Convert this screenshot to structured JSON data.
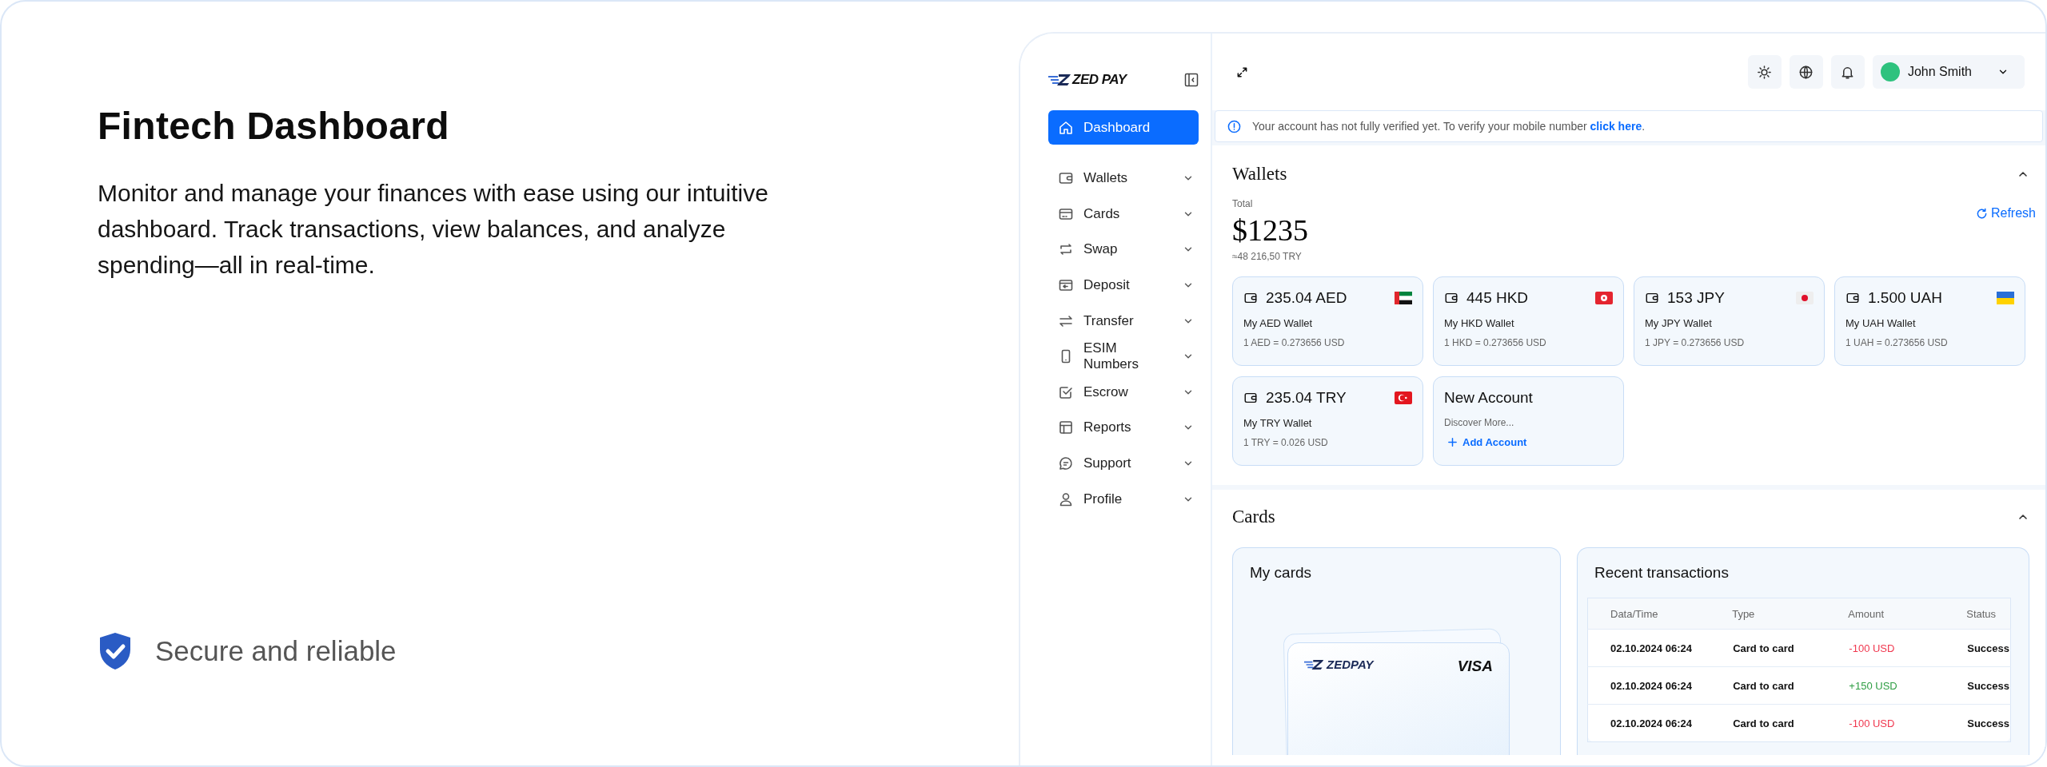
{
  "intro": {
    "title": "Fintech Dashboard",
    "description": "Monitor and manage your finances with ease using our intuitive dashboard. Track transactions, view balances, and analyze spending—all in real-time.",
    "badge": "Secure and reliable"
  },
  "sidebar": {
    "logo": "ZED PAY",
    "items": [
      {
        "label": "Dashboard",
        "selected": true,
        "kind": "link"
      },
      {
        "label": "Wallets",
        "selected": false,
        "kind": "menu"
      },
      {
        "label": "Cards",
        "selected": false,
        "kind": "menu"
      },
      {
        "label": "Swap",
        "selected": false,
        "kind": "menu"
      },
      {
        "label": "Deposit",
        "selected": false,
        "kind": "menu"
      },
      {
        "label": "Transfer",
        "selected": false,
        "kind": "menu"
      },
      {
        "label": "ESIM Numbers",
        "selected": false,
        "kind": "menu"
      },
      {
        "label": "Escrow",
        "selected": false,
        "kind": "menu"
      },
      {
        "label": "Reports",
        "selected": false,
        "kind": "menu"
      },
      {
        "label": "Support",
        "selected": false,
        "kind": "menu"
      },
      {
        "label": "Profile",
        "selected": false,
        "kind": "menu"
      }
    ]
  },
  "header": {
    "user": "John Smith"
  },
  "alert": {
    "message": "Your account has not fully verified yet. To verify your mobile number",
    "link": "click here",
    "end": "."
  },
  "wallets": {
    "title": "Wallets",
    "expanded": true,
    "total_label": "Total",
    "total": "$1235",
    "total_converted": "≈48 216,50 TRY",
    "refresh": "Refresh",
    "accounts": [
      {
        "kind": "wallet",
        "amount": "235.04 AED",
        "name": "My AED Wallet",
        "rate": "1 AED = 0.273656 USD"
      },
      {
        "kind": "wallet",
        "amount": "445 HKD",
        "name": "My HKD Wallet",
        "rate": "1 HKD = 0.273656 USD"
      },
      {
        "kind": "wallet",
        "amount": "153 JPY",
        "name": "My JPY Wallet",
        "rate": "1 JPY = 0.273656 USD"
      },
      {
        "kind": "wallet",
        "amount": "1.500 UAH",
        "name": "My UAH Wallet",
        "rate": "1 UAH = 0.273656 USD"
      },
      {
        "kind": "wallet",
        "amount": "235.04 TRY",
        "name": "My TRY Wallet",
        "rate": "1 TRY = 0.026 USD"
      },
      {
        "kind": "new",
        "title": "New Account",
        "subtitle": "Discover More...",
        "action": "Add Account"
      }
    ]
  },
  "cards": {
    "title": "Cards",
    "expanded": true,
    "my_cards": {
      "title": "My cards",
      "card_brand": "ZEDPAY",
      "card_network": "VISA"
    },
    "transactions": {
      "title": "Recent transactions",
      "columns": [
        "Data/Time",
        "Type",
        "Amount",
        "Status"
      ],
      "rows": [
        {
          "datetime": "02.10.2024 06:24",
          "type": "Card to card",
          "amount": "-100 USD",
          "color": "#f0384f",
          "status": "Success"
        },
        {
          "datetime": "02.10.2024 06:24",
          "type": "Card to card",
          "amount": "+150 USD",
          "color": "#2f9e44",
          "status": "Success"
        },
        {
          "datetime": "02.10.2024 06:24",
          "type": "Card to card",
          "amount": "-100 USD",
          "color": "#f0384f",
          "status": "Success"
        }
      ]
    }
  }
}
